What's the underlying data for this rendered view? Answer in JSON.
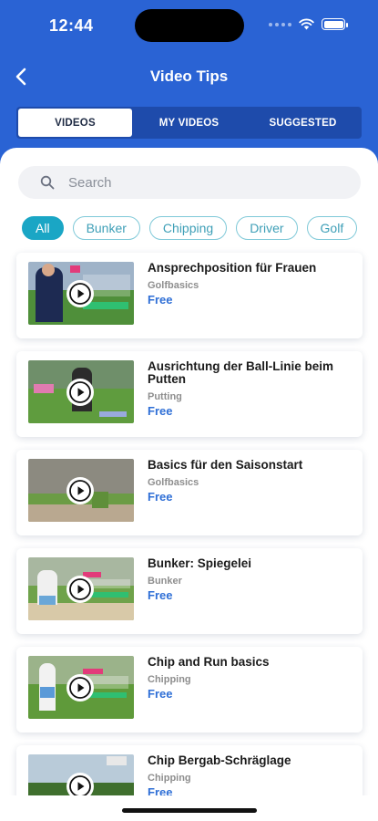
{
  "status_bar": {
    "time": "12:44"
  },
  "header": {
    "title": "Video Tips"
  },
  "tabs": [
    {
      "label": "VIDEOS",
      "active": true
    },
    {
      "label": "MY VIDEOS",
      "active": false
    },
    {
      "label": "SUGGESTED",
      "active": false
    }
  ],
  "search": {
    "placeholder": "Search"
  },
  "filters": [
    {
      "label": "All",
      "active": true
    },
    {
      "label": "Bunker",
      "active": false
    },
    {
      "label": "Chipping",
      "active": false
    },
    {
      "label": "Driver",
      "active": false
    },
    {
      "label": "Golf",
      "active": false
    }
  ],
  "videos": [
    {
      "title": "Ansprechposition für Frauen",
      "category": "Golfbasics",
      "price": "Free"
    },
    {
      "title": "Ausrichtung der Ball-Linie beim Putten",
      "category": "Putting",
      "price": "Free"
    },
    {
      "title": "Basics für den Saisonstart",
      "category": "Golfbasics",
      "price": "Free"
    },
    {
      "title": "Bunker: Spiegelei",
      "category": "Bunker",
      "price": "Free"
    },
    {
      "title": "Chip and Run basics",
      "category": "Chipping",
      "price": "Free"
    },
    {
      "title": "Chip Bergab-Schräglage",
      "category": "Chipping",
      "price": "Free"
    }
  ],
  "colors": {
    "primary": "#2a63d4",
    "accent": "#1aa6c5",
    "price": "#2f6fd6"
  }
}
